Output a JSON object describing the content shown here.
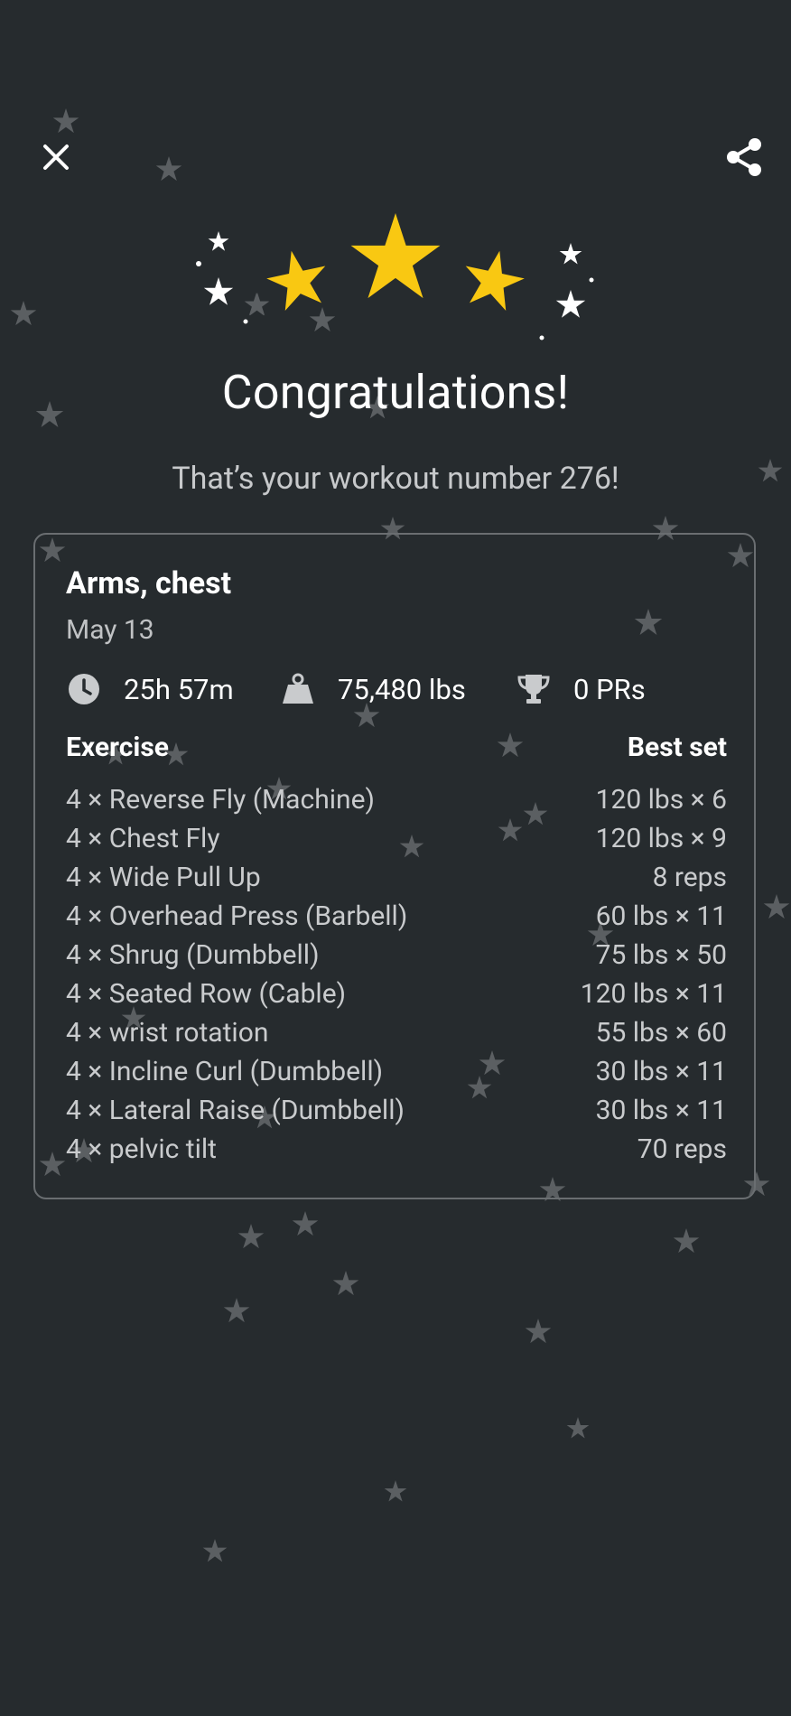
{
  "header": {
    "close_icon": "close-icon",
    "share_icon": "share-icon"
  },
  "hero": {
    "title": "Congratulations!",
    "subtitle": "That’s your workout number 276!",
    "star_color": "#f9c812"
  },
  "workout": {
    "name": "Arms, chest",
    "date": "May 13",
    "stats": {
      "duration": "25h 57m",
      "volume": "75,480 lbs",
      "prs": "0 PRs"
    },
    "table_headers": {
      "exercise": "Exercise",
      "best_set": "Best set"
    },
    "exercises": [
      {
        "name": "4 × Reverse Fly (Machine)",
        "best": "120 lbs × 6"
      },
      {
        "name": "4 × Chest Fly",
        "best": "120 lbs × 9"
      },
      {
        "name": "4 × Wide Pull Up",
        "best": "8 reps"
      },
      {
        "name": "4 × Overhead Press (Barbell)",
        "best": "60 lbs × 11"
      },
      {
        "name": "4 × Shrug (Dumbbell)",
        "best": "75 lbs × 50"
      },
      {
        "name": "4 × Seated Row (Cable)",
        "best": "120 lbs × 11"
      },
      {
        "name": "4 × wrist rotation",
        "best": "55 lbs × 60"
      },
      {
        "name": "4 × Incline Curl (Dumbbell)",
        "best": "30 lbs × 11"
      },
      {
        "name": "4 × Lateral Raise (Dumbbell)",
        "best": "30 lbs × 11"
      },
      {
        "name": "4 × pelvic tilt",
        "best": "70 reps"
      }
    ]
  },
  "colors": {
    "background": "#262b2e",
    "card_border": "#6a6e71",
    "confetti_star": "#5b5f62"
  }
}
